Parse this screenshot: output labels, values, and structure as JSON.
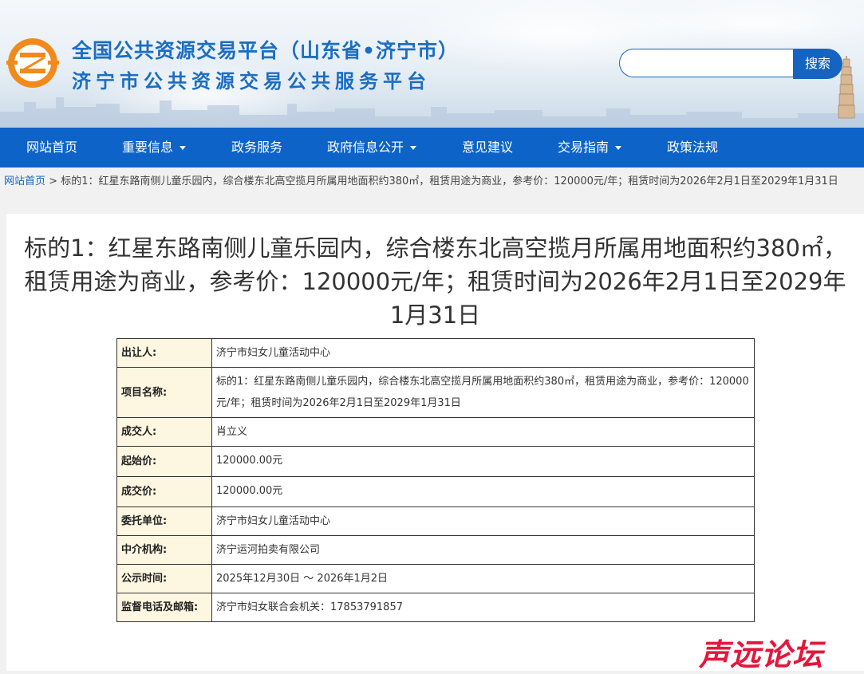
{
  "header": {
    "title_line1": "全国公共资源交易平台（山东省•济宁市）",
    "title_line2": "济宁市公共资源交易公共服务平台",
    "search": {
      "placeholder": "",
      "button_label": "搜索"
    },
    "colors": {
      "title": "#1c6ec3",
      "brand_orange": "#f08a1c",
      "nav_bg": "#0d63c8"
    }
  },
  "nav": {
    "items": [
      {
        "label": "网站首页",
        "has_dropdown": false
      },
      {
        "label": "重要信息",
        "has_dropdown": true
      },
      {
        "label": "政务服务",
        "has_dropdown": false
      },
      {
        "label": "政府信息公开",
        "has_dropdown": true
      },
      {
        "label": "意见建议",
        "has_dropdown": false
      },
      {
        "label": "交易指南",
        "has_dropdown": true
      },
      {
        "label": "政策法规",
        "has_dropdown": false
      }
    ]
  },
  "breadcrumb": {
    "home": "网站首页",
    "separator": " > ",
    "current": "标的1：红星东路南侧儿童乐园内，综合楼东北高空揽月所属用地面积约380㎡，租赁用途为商业，参考价：120000元/年；租赁时间为2026年2月1日至2029年1月31日"
  },
  "article": {
    "title": "标的1：红星东路南侧儿童乐园内，综合楼东北高空揽月所属用地面积约380㎡，租赁用途为商业，参考价：120000元/年；租赁时间为2026年2月1日至2029年1月31日",
    "rows": [
      {
        "label": "出让人:",
        "value": "济宁市妇女儿童活动中心"
      },
      {
        "label": "项目名称:",
        "value": "标的1：红星东路南侧儿童乐园内，综合楼东北高空揽月所属用地面积约380㎡，租赁用途为商业，参考价：120000元/年；租赁时间为2026年2月1日至2029年1月31日"
      },
      {
        "label": "成交人:",
        "value": "肖立义"
      },
      {
        "label": "起始价:",
        "value": "120000.00元"
      },
      {
        "label": "成交价:",
        "value": "120000.00元"
      },
      {
        "label": "委托单位:",
        "value": "济宁市妇女儿童活动中心"
      },
      {
        "label": "中介机构:",
        "value": "济宁运河拍卖有限公司"
      },
      {
        "label": "公示时间:",
        "value": "2025年12月30日 ～ 2026年1月2日"
      },
      {
        "label": "监督电话及邮箱:",
        "value": "济宁市妇女联合会机关：17853791857"
      }
    ]
  },
  "watermark": {
    "text": "声远论坛"
  }
}
